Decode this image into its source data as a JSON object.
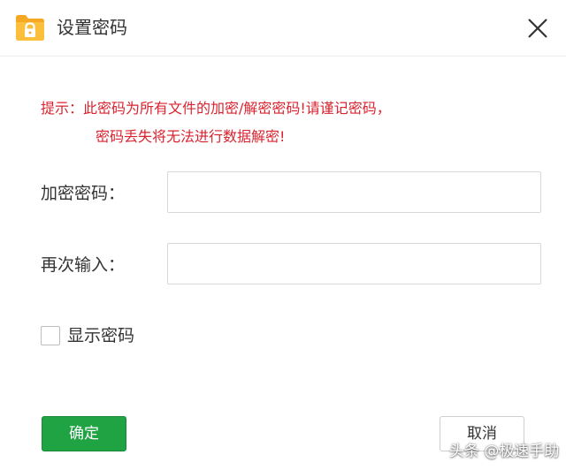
{
  "dialog": {
    "title": "设置密码",
    "icon": "folder-lock-icon",
    "close_icon": "close-icon"
  },
  "hint": {
    "line1": "提示：此密码为所有文件的加密/解密密码!请谨记密码，",
    "line2": "密码丢失将无法进行数据解密!"
  },
  "form": {
    "password_label": "加密密码：",
    "password_value": "",
    "confirm_label": "再次输入：",
    "confirm_value": "",
    "show_password_label": "显示密码",
    "show_password_checked": false
  },
  "buttons": {
    "ok": "确定",
    "cancel": "取消"
  },
  "watermark": "头条 @极速手助",
  "colors": {
    "accent_green": "#1fa343",
    "warning_red": "#d9232f",
    "folder_orange": "#f7a823"
  }
}
